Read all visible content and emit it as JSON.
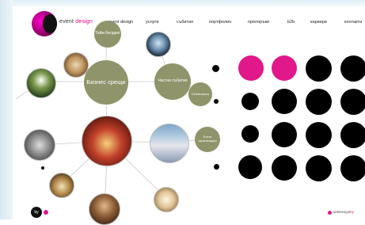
{
  "brand": {
    "part1": "event ",
    "part2": "design"
  },
  "nav": [
    {
      "label": "event design"
    },
    {
      "label": "услуги"
    },
    {
      "label": "събития"
    },
    {
      "label": "портфолио"
    },
    {
      "label": "препоръки"
    },
    {
      "label": "b2b"
    },
    {
      "label": "кариери"
    },
    {
      "label": "контакти"
    }
  ],
  "bubbles": {
    "business_meetings": "Бизнес срещи",
    "private_events": "Частни събития",
    "team_building": "Тийм билдинг",
    "celebrations": "Celebrations",
    "event_organization": "Event организация"
  },
  "footer": {
    "by": "by",
    "credit_a": "webDesign",
    "credit_b": "by"
  },
  "colors": {
    "accent": "#e0188a",
    "olive": "#8f946b",
    "dot": "#000000"
  }
}
